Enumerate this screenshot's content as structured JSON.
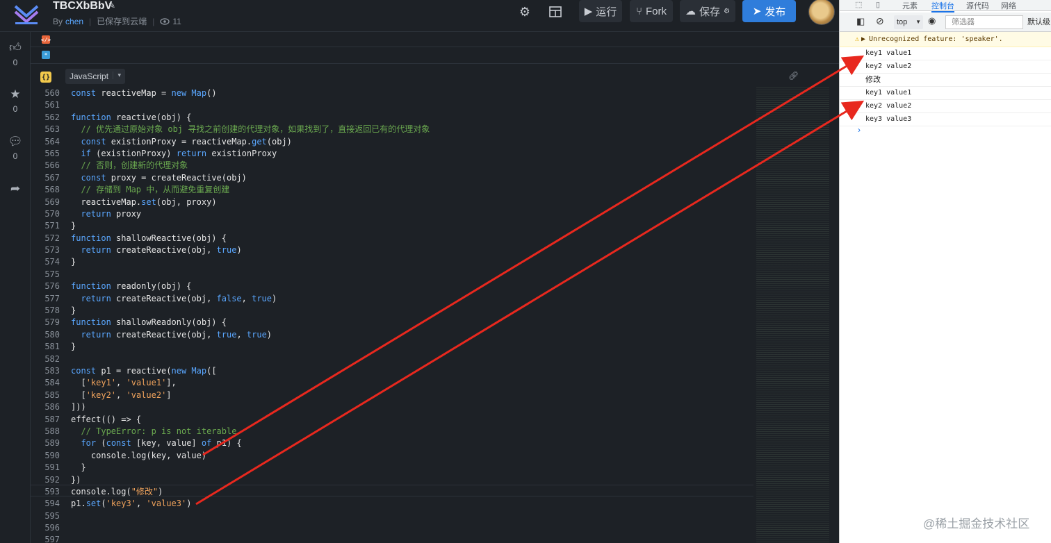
{
  "header": {
    "title": "TBCXbBbV",
    "by_label": "By",
    "author": "chen",
    "save_status": "已保存到云端",
    "view_count": "11",
    "run_label": "运行",
    "fork_label": "Fork",
    "save_label": "保存",
    "publish_label": "发布"
  },
  "rail": {
    "likes": "0",
    "stars": "0",
    "comments": "0"
  },
  "panels": {
    "html_tag": "</>",
    "css_tag": "*",
    "js_tag": "{}",
    "language": "JavaScript"
  },
  "editor": {
    "line_numbers": [
      "560",
      "561",
      "562",
      "563",
      "564",
      "565",
      "566",
      "567",
      "568",
      "569",
      "570",
      "571",
      "572",
      "573",
      "574",
      "575",
      "576",
      "577",
      "578",
      "579",
      "580",
      "581",
      "582",
      "583",
      "584",
      "585",
      "586",
      "587",
      "588",
      "589",
      "590",
      "591",
      "592",
      "593",
      "594",
      "595",
      "596",
      "597"
    ],
    "lines": [
      "const reactiveMap = new Map()",
      "",
      "function reactive(obj) {",
      "  // 优先通过原始对象 obj 寻找之前创建的代理对象，如果找到了，直接返回已有的代理对象",
      "  const existionProxy = reactiveMap.get(obj)",
      "  if (existionProxy) return existionProxy",
      "  // 否则，创建新的代理对象",
      "  const proxy = createReactive(obj)",
      "  // 存储到 Map 中，从而避免重复创建",
      "  reactiveMap.set(obj, proxy)",
      "  return proxy",
      "}",
      "function shallowReactive(obj) {",
      "  return createReactive(obj, true)",
      "}",
      "",
      "function readonly(obj) {",
      "  return createReactive(obj, false, true)",
      "}",
      "function shallowReadonly(obj) {",
      "  return createReactive(obj, true, true)",
      "}",
      "",
      "const p1 = reactive(new Map([",
      "  ['key1', 'value1'],",
      "  ['key2', 'value2']",
      "]))",
      "effect(() => {",
      "  // TypeError: p is not iterable",
      "  for (const [key, value] of p1) {",
      "    console.log(key, value)",
      "  }",
      "})",
      "console.log(\"修改\")",
      "p1.set('key3', 'value3')",
      "",
      "",
      ""
    ]
  },
  "devtools": {
    "tabs": [
      "元素",
      "控制台",
      "源代码",
      "网络"
    ],
    "context": "top",
    "filter_placeholder": "筛选器",
    "levels": "默认级",
    "warning": "Unrecognized feature: 'speaker'.",
    "console": [
      "key1 value1",
      "key2 value2",
      "修改",
      "key1 value1",
      "key2 value2",
      "key3 value3"
    ]
  },
  "watermark": "@稀土掘金技术社区",
  "colors": {
    "editor_bg": "#1d2126",
    "keyword": "#5aa7ff",
    "comment": "#6aa84f",
    "string": "#f0a35c",
    "publish": "#2f7ddb",
    "annotation_arrow": "#e8281e"
  }
}
